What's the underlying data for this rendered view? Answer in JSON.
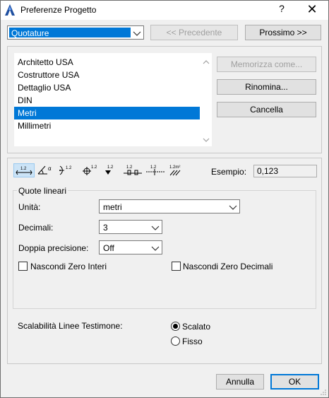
{
  "window": {
    "title": "Preferenze Progetto",
    "help": "?",
    "close": "✕"
  },
  "top": {
    "category_value": "Quotature",
    "prev_label": "<< Precedente",
    "next_label": "Prossimo >>"
  },
  "presets": {
    "items": [
      "Architetto USA",
      "Costruttore USA",
      "Dettaglio USA",
      "DIN",
      "Metri",
      "Millimetri"
    ],
    "selected": "Metri"
  },
  "actions": {
    "store_as": "Memorizza come...",
    "rename": "Rinomina...",
    "delete": "Cancella"
  },
  "toolbar": {
    "icons": [
      {
        "name": "linear-dimension-icon",
        "text": "1.2"
      },
      {
        "name": "angle-dimension-icon",
        "text": "α"
      },
      {
        "name": "radius-dimension-icon",
        "text": "1.2"
      },
      {
        "name": "level-dimension-icon",
        "text": "1.2"
      },
      {
        "name": "elevation-dimension-icon",
        "text": "1.2"
      },
      {
        "name": "door-window-dimension-icon",
        "text": "1.2"
      },
      {
        "name": "sill-height-icon",
        "text": "1.2"
      },
      {
        "name": "area-calculation-icon",
        "text": "1.2m²"
      }
    ],
    "example_label": "Esempio:",
    "example_value": "0,123"
  },
  "linear": {
    "group_title": "Quote lineari",
    "unit_label": "Unità:",
    "unit_value": "metri",
    "decimals_label": "Decimali:",
    "decimals_value": "3",
    "double_label": "Doppia precisione:",
    "double_value": "Off",
    "hide_zero_int": "Nascondi Zero Interi",
    "hide_zero_dec": "Nascondi Zero Decimali"
  },
  "witness": {
    "label": "Scalabilità Linee Testimone:",
    "option_scaled": "Scalato",
    "option_fixed": "Fisso",
    "selected": "Scalato"
  },
  "footer": {
    "cancel": "Annulla",
    "ok": "OK"
  },
  "colors": {
    "accent": "#0078d7"
  }
}
